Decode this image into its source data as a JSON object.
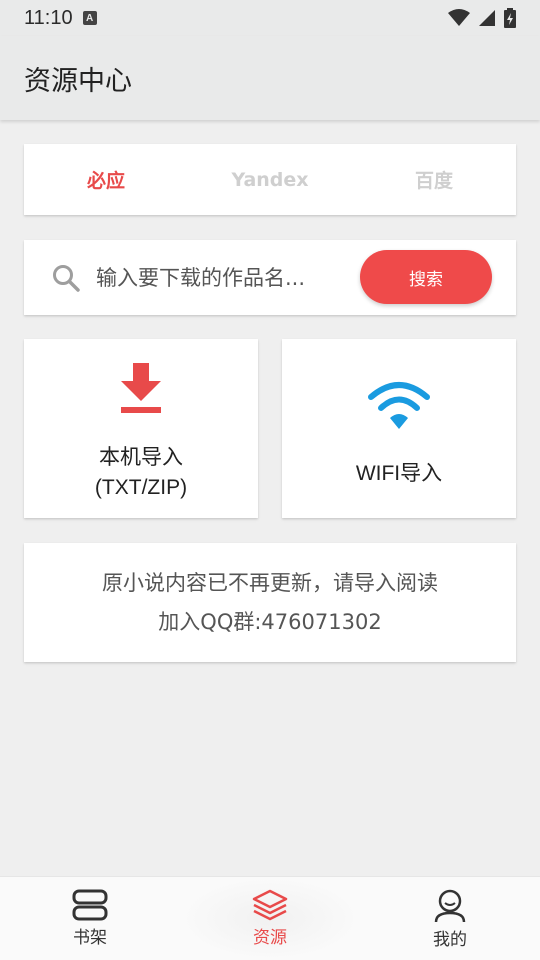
{
  "status_bar": {
    "time": "11:10",
    "a_badge": "A"
  },
  "app_bar": {
    "title": "资源中心"
  },
  "tabs": [
    {
      "label": "必应",
      "active": true
    },
    {
      "label": "Yandex",
      "active": false
    },
    {
      "label": "百度",
      "active": false
    }
  ],
  "search": {
    "placeholder": "输入要下载的作品名...",
    "button_label": "搜索"
  },
  "import": {
    "local": {
      "line1": "本机导入",
      "line2": "(TXT/ZIP)",
      "icon": "download-icon",
      "color": "#e84a4a"
    },
    "wifi": {
      "label": "WIFI导入",
      "icon": "wifi-icon",
      "color": "#1a9be0"
    }
  },
  "notice": {
    "line1": "原小说内容已不再更新，请导入阅读",
    "line2": "加入QQ群:476071302"
  },
  "bottom_nav": [
    {
      "label": "书架",
      "icon": "bookshelf-icon",
      "active": false
    },
    {
      "label": "资源",
      "icon": "layers-icon",
      "active": true
    },
    {
      "label": "我的",
      "icon": "user-icon",
      "active": false
    }
  ],
  "colors": {
    "accent": "#e84a4a",
    "wifi_blue": "#1a9be0"
  }
}
